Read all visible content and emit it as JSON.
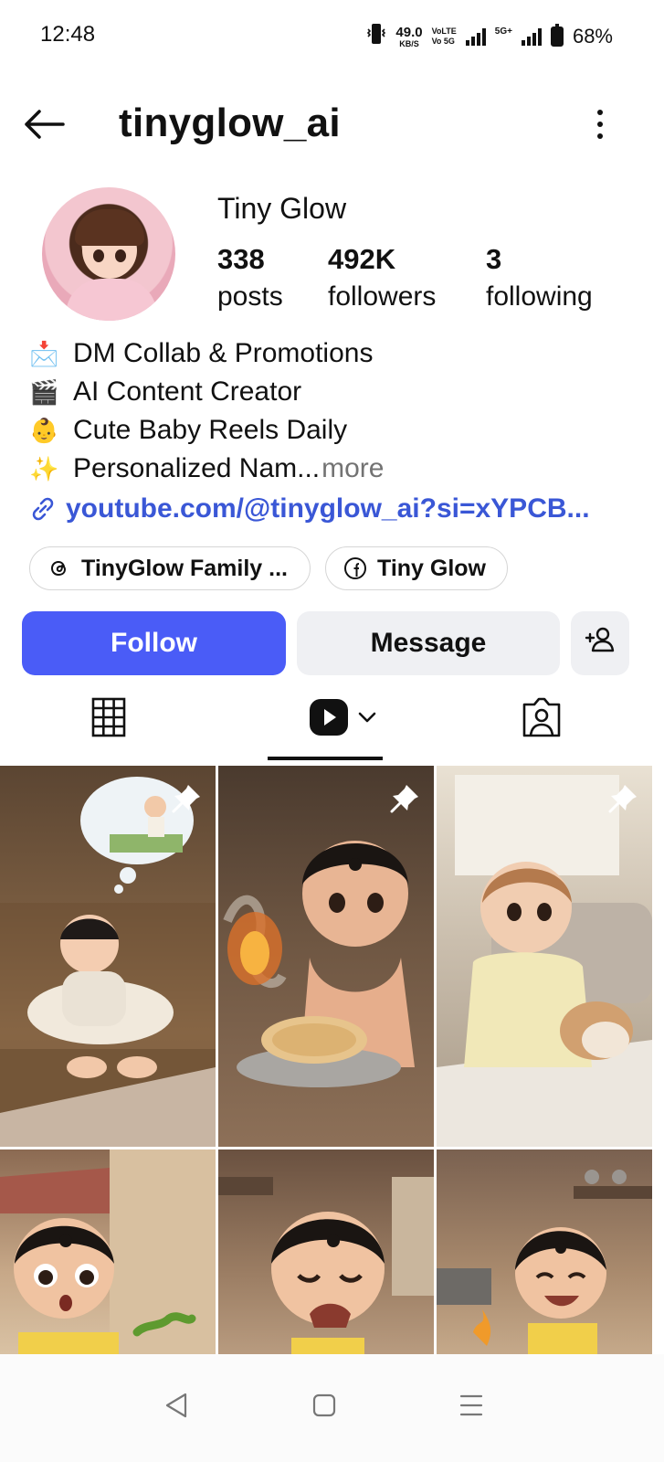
{
  "status_bar": {
    "time": "12:48",
    "net_speed_value": "49.0",
    "net_speed_unit": "KB/S",
    "volte_top": "VoLTE",
    "volte_bottom": "Vo 5G",
    "network": "5G+",
    "battery": "68%"
  },
  "header": {
    "username": "tinyglow_ai",
    "icons": [
      "back-arrow-icon",
      "more-options-icon"
    ]
  },
  "profile": {
    "display_name": "Tiny Glow",
    "stats": [
      {
        "value": "338",
        "label": "posts"
      },
      {
        "value": "492K",
        "label": "followers"
      },
      {
        "value": "3",
        "label": "following"
      }
    ]
  },
  "bio": {
    "lines": [
      {
        "emoji": "📩",
        "text": "DM Collab & Promotions"
      },
      {
        "emoji": "🎬",
        "text": "AI Content Creator"
      },
      {
        "emoji": "👶",
        "text": "Cute Baby Reels Daily"
      },
      {
        "emoji": "✨",
        "text": "Personalized Nam..."
      }
    ],
    "more_label": "more",
    "link": "youtube.com/@tinyglow_ai?si=xYPCB..."
  },
  "chips": [
    {
      "label": "TinyGlow Family ...",
      "icon": "threads-icon"
    },
    {
      "label": "Tiny Glow",
      "icon": "facebook-icon"
    }
  ],
  "actions": {
    "follow": "Follow",
    "message": "Message",
    "suggest_icon": "add-person-icon"
  },
  "tabs": [
    {
      "name": "grid",
      "icon": "grid-icon"
    },
    {
      "name": "reels",
      "icon": "reels-icon",
      "active": true
    },
    {
      "name": "tagged",
      "icon": "tagged-icon"
    }
  ],
  "grid_tiles": [
    {
      "scene": "sleeping-baby-dream",
      "pinned": true
    },
    {
      "scene": "baby-with-roti",
      "pinned": true
    },
    {
      "scene": "baby-with-hamster",
      "pinned": true
    },
    {
      "scene": "surprised-baby-caterpillar",
      "pinned": false
    },
    {
      "scene": "crying-baby-kitchen",
      "pinned": false
    },
    {
      "scene": "smiling-baby-kitchen",
      "pinned": false
    }
  ],
  "nav": [
    "back-nav-icon",
    "home-nav-icon",
    "recents-nav-icon"
  ],
  "colors": {
    "accent": "#4a5cf7",
    "link": "#3a57d6",
    "secondary_button": "#eff0f3",
    "muted_text": "#737373"
  }
}
